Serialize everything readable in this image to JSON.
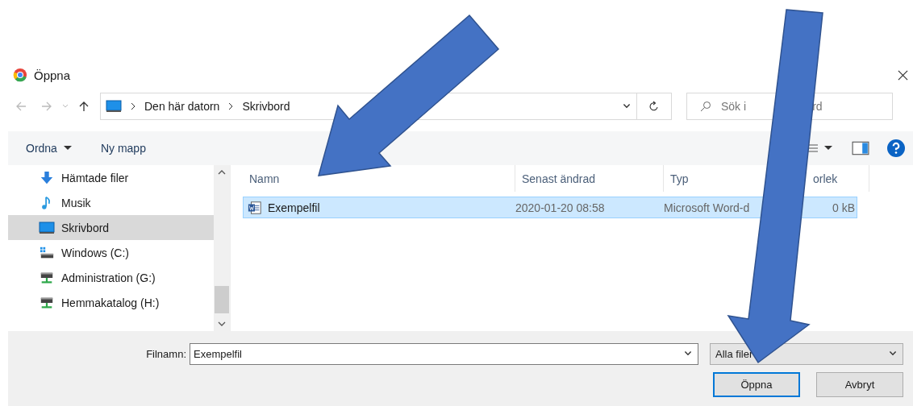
{
  "window": {
    "title": "Öppna"
  },
  "address": {
    "path": [
      "Den här datorn",
      "Skrivbord"
    ]
  },
  "search": {
    "visible_text": [
      "Sök i",
      "rd"
    ]
  },
  "toolbar": {
    "buttons": [
      {
        "label": "Ordna",
        "kind": "menu"
      },
      {
        "label": "Ny mapp",
        "kind": "plain"
      }
    ]
  },
  "sidebar": {
    "items": [
      {
        "label": "Hämtade filer",
        "kind": "download",
        "selected": false
      },
      {
        "label": "Musik",
        "kind": "music",
        "selected": false
      },
      {
        "label": "Skrivbord",
        "kind": "desktop",
        "selected": true
      },
      {
        "label": "Windows (C:)",
        "kind": "system-drive",
        "selected": false
      },
      {
        "label": "Administration (G:)",
        "kind": "network-drive",
        "selected": false
      },
      {
        "label": "Hemmakatalog (H:)",
        "kind": "network-drive",
        "selected": false
      }
    ]
  },
  "table": {
    "columns": [
      "Namn",
      "Senast ändrad",
      "Typ",
      "orlek"
    ],
    "rows": [
      {
        "name": "Exempelfil",
        "modified": "2020-01-20 08:58",
        "type": "Microsoft Word-d",
        "size": "0 kB",
        "selected": true
      }
    ]
  },
  "footer": {
    "filename_label": "Filnamn:",
    "filename": "Exempelfil",
    "filter": "Alla filer",
    "buttons": [
      {
        "label": "Öppna",
        "default": true
      },
      {
        "label": "Avbryt",
        "default": false
      }
    ]
  }
}
